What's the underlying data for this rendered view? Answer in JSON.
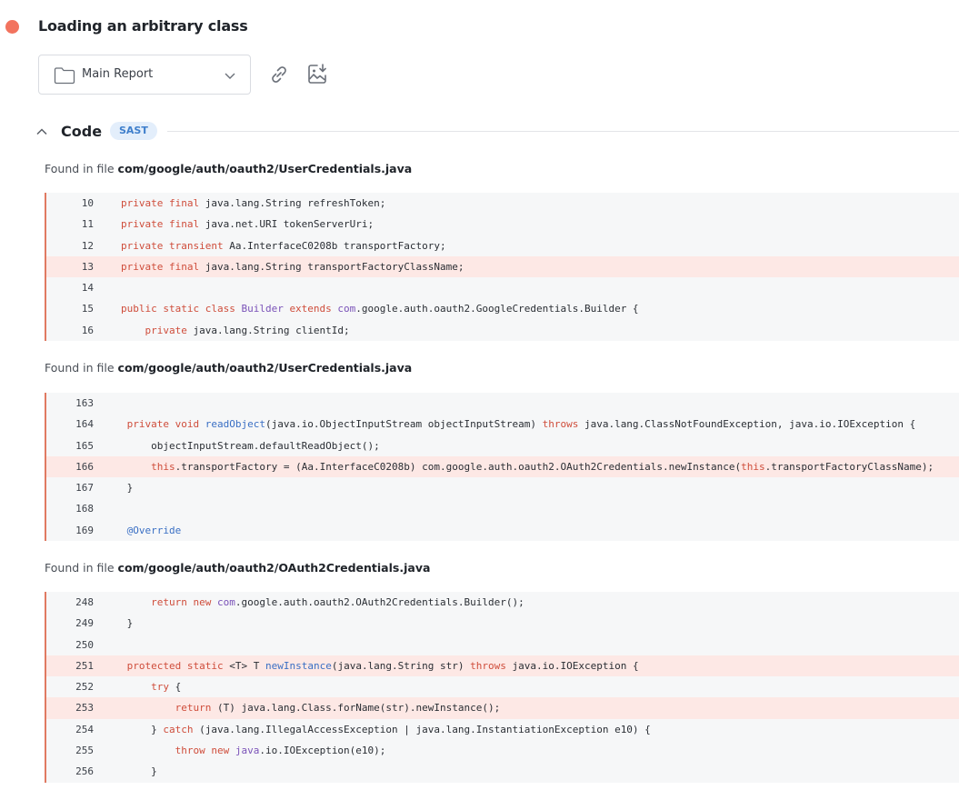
{
  "finding": {
    "title": "Loading an arbitrary class",
    "severity_color": "#f2735e"
  },
  "report_select": {
    "label": "Main Report"
  },
  "section": {
    "title": "Code",
    "badge": "SAST"
  },
  "snippets": [
    {
      "found_prefix": "Found in file",
      "file": "com/google/auth/oauth2/UserCredentials.java",
      "lines": [
        {
          "n": "10",
          "hl": false,
          "tokens": [
            [
              "kw",
              "private final "
            ],
            [
              "",
              "java.lang.String refreshToken;"
            ]
          ]
        },
        {
          "n": "11",
          "hl": false,
          "tokens": [
            [
              "kw",
              "private final "
            ],
            [
              "",
              "java.net.URI tokenServerUri;"
            ]
          ]
        },
        {
          "n": "12",
          "hl": false,
          "tokens": [
            [
              "kw",
              "private transient "
            ],
            [
              "",
              "Aa.InterfaceC0208b transportFactory;"
            ]
          ]
        },
        {
          "n": "13",
          "hl": true,
          "tokens": [
            [
              "kw",
              "private final "
            ],
            [
              "",
              "java.lang.String transportFactoryClassName;"
            ]
          ]
        },
        {
          "n": "14",
          "hl": false,
          "tokens": []
        },
        {
          "n": "15",
          "hl": false,
          "tokens": [
            [
              "kw",
              "public static class "
            ],
            [
              "tp",
              "Builder "
            ],
            [
              "kw",
              "extends "
            ],
            [
              "tp",
              "com"
            ],
            [
              "",
              ".google.auth.oauth2.GoogleCredentials.Builder {"
            ]
          ]
        },
        {
          "n": "16",
          "hl": false,
          "tokens": [
            [
              "",
              "    "
            ],
            [
              "kw",
              "private "
            ],
            [
              "",
              "java.lang.String clientId;"
            ]
          ]
        }
      ]
    },
    {
      "found_prefix": "Found in file",
      "file": "com/google/auth/oauth2/UserCredentials.java",
      "lines": [
        {
          "n": "163",
          "hl": false,
          "tokens": []
        },
        {
          "n": "164",
          "hl": false,
          "tokens": [
            [
              "kw",
              " private void "
            ],
            [
              "fn",
              "readObject"
            ],
            [
              "",
              "(java.io.ObjectInputStream objectInputStream) "
            ],
            [
              "kw",
              "throws "
            ],
            [
              "",
              "java.lang.ClassNotFoundException, java.io.IOException {"
            ]
          ]
        },
        {
          "n": "165",
          "hl": false,
          "tokens": [
            [
              "",
              "     objectInputStream.defaultReadObject();"
            ]
          ]
        },
        {
          "n": "166",
          "hl": true,
          "tokens": [
            [
              "",
              "     "
            ],
            [
              "kw",
              "this"
            ],
            [
              "",
              ".transportFactory = (Aa.InterfaceC0208b) com.google.auth.oauth2.OAuth2Credentials.newInstance("
            ],
            [
              "kw",
              "this"
            ],
            [
              "",
              ".transportFactoryClassName);"
            ]
          ]
        },
        {
          "n": "167",
          "hl": false,
          "tokens": [
            [
              "",
              " }"
            ]
          ]
        },
        {
          "n": "168",
          "hl": false,
          "tokens": []
        },
        {
          "n": "169",
          "hl": false,
          "tokens": [
            [
              "an",
              " @Override"
            ]
          ]
        }
      ]
    },
    {
      "found_prefix": "Found in file",
      "file": "com/google/auth/oauth2/OAuth2Credentials.java",
      "lines": [
        {
          "n": "248",
          "hl": false,
          "tokens": [
            [
              "",
              "     "
            ],
            [
              "kw",
              "return new "
            ],
            [
              "tp",
              "com"
            ],
            [
              "",
              ".google.auth.oauth2.OAuth2Credentials.Builder();"
            ]
          ]
        },
        {
          "n": "249",
          "hl": false,
          "tokens": [
            [
              "",
              " }"
            ]
          ]
        },
        {
          "n": "250",
          "hl": false,
          "tokens": []
        },
        {
          "n": "251",
          "hl": true,
          "tokens": [
            [
              "kw",
              " protected static "
            ],
            [
              "",
              "<T> T "
            ],
            [
              "fn",
              "newInstance"
            ],
            [
              "",
              "(java.lang.String str) "
            ],
            [
              "kw",
              "throws "
            ],
            [
              "",
              "java.io.IOException {"
            ]
          ]
        },
        {
          "n": "252",
          "hl": false,
          "tokens": [
            [
              "",
              "     "
            ],
            [
              "kw",
              "try "
            ],
            [
              "",
              "{"
            ]
          ]
        },
        {
          "n": "253",
          "hl": true,
          "tokens": [
            [
              "",
              "         "
            ],
            [
              "kw",
              "return "
            ],
            [
              "",
              "(T) java.lang.Class.forName(str).newInstance();"
            ]
          ]
        },
        {
          "n": "254",
          "hl": false,
          "tokens": [
            [
              "",
              "     } "
            ],
            [
              "kw",
              "catch "
            ],
            [
              "",
              "(java.lang.IllegalAccessException | java.lang.InstantiationException e10) {"
            ]
          ]
        },
        {
          "n": "255",
          "hl": false,
          "tokens": [
            [
              "",
              "         "
            ],
            [
              "kw",
              "throw new "
            ],
            [
              "tp",
              "java"
            ],
            [
              "",
              ".io.IOException(e10);"
            ]
          ]
        },
        {
          "n": "256",
          "hl": false,
          "tokens": [
            [
              "",
              "     }"
            ]
          ]
        }
      ]
    }
  ]
}
